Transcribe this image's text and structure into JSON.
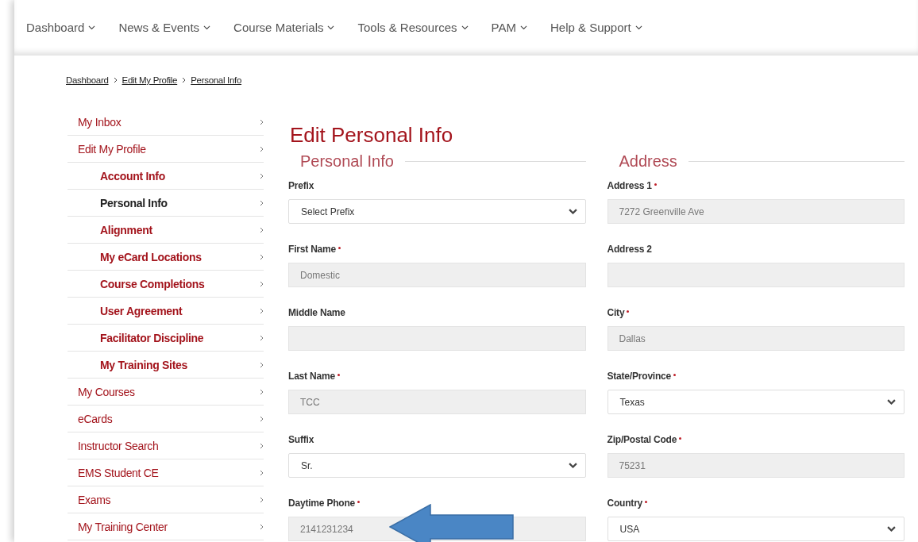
{
  "nav": [
    {
      "label": "Dashboard"
    },
    {
      "label": "News & Events"
    },
    {
      "label": "Course Materials"
    },
    {
      "label": "Tools & Resources"
    },
    {
      "label": "PAM"
    },
    {
      "label": "Help & Support"
    }
  ],
  "breadcrumb": [
    "Dashboard",
    "Edit My Profile",
    "Personal Info"
  ],
  "sidebar": {
    "items": [
      {
        "label": "My Inbox",
        "selected": false
      },
      {
        "label": "Edit My Profile",
        "selected": false,
        "children": [
          {
            "label": "Account Info",
            "selected": false
          },
          {
            "label": "Personal Info",
            "selected": true
          },
          {
            "label": "Alignment",
            "selected": false
          },
          {
            "label": "My eCard Locations",
            "selected": false
          },
          {
            "label": "Course Completions",
            "selected": false
          },
          {
            "label": "User Agreement",
            "selected": false
          },
          {
            "label": "Facilitator Discipline",
            "selected": false
          },
          {
            "label": "My Training Sites",
            "selected": false
          }
        ]
      },
      {
        "label": "My Courses",
        "selected": false
      },
      {
        "label": "eCards",
        "selected": false
      },
      {
        "label": "Instructor Search",
        "selected": false
      },
      {
        "label": "EMS Student CE",
        "selected": false
      },
      {
        "label": "Exams",
        "selected": false
      },
      {
        "label": "My Training Center",
        "selected": false
      }
    ]
  },
  "title": "Edit Personal Info",
  "sections": [
    {
      "heading": "Personal Info",
      "fields": [
        {
          "kind": "select",
          "label": "Prefix",
          "required": false,
          "value": "Select Prefix",
          "highlighted": false
        },
        {
          "kind": "text",
          "label": "First Name",
          "required": true,
          "value": "Domestic",
          "highlighted": false
        },
        {
          "kind": "text",
          "label": "Middle Name",
          "required": false,
          "highlighted": false
        },
        {
          "kind": "text",
          "label": "Last Name",
          "required": true,
          "value": "TCC",
          "highlighted": false
        },
        {
          "kind": "select",
          "label": "Suffix",
          "required": false,
          "value": "Sr.",
          "highlighted": false
        },
        {
          "kind": "text",
          "label": "Daytime Phone",
          "required": true,
          "value": "2141231234",
          "highlighted": true
        }
      ]
    },
    {
      "heading": "Address",
      "fields": [
        {
          "kind": "text",
          "label": "Address 1",
          "required": true,
          "value": "7272 Greenville Ave",
          "highlighted": false
        },
        {
          "kind": "text",
          "label": "Address 2",
          "required": false,
          "highlighted": false
        },
        {
          "kind": "text",
          "label": "City",
          "required": true,
          "value": "Dallas",
          "highlighted": false
        },
        {
          "kind": "select",
          "label": "State/Province",
          "required": true,
          "value": "Texas",
          "highlighted": false
        },
        {
          "kind": "text",
          "label": "Zip/Postal Code",
          "required": true,
          "value": "75231",
          "highlighted": false
        },
        {
          "kind": "select",
          "label": "Country",
          "required": true,
          "value": "USA",
          "highlighted": false
        }
      ]
    }
  ]
}
